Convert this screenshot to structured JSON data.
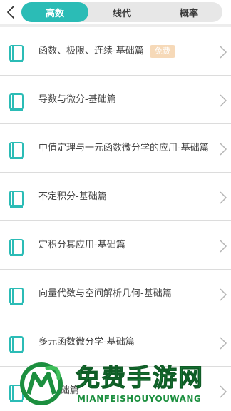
{
  "colors": {
    "accent": "#2bbcb6",
    "badge": "#f6d9b8",
    "watermark": "#1c8f3f"
  },
  "header": {
    "back_icon": "chevron-left-icon",
    "tabs": [
      {
        "label": "高数",
        "active": true
      },
      {
        "label": "线代",
        "active": false
      },
      {
        "label": "概率",
        "active": false
      }
    ]
  },
  "list": {
    "item_icon": "book-icon",
    "items": [
      {
        "title": "函数、极限、连续-基础篇",
        "badge": "免费"
      },
      {
        "title": "导数与微分-基础篇"
      },
      {
        "title": "中值定理与一元函数微分学的应用-基础篇"
      },
      {
        "title": "不定积分-基础篇"
      },
      {
        "title": "定积分其应用-基础篇"
      },
      {
        "title": "向量代数与空间解析几何-基础篇"
      },
      {
        "title": "多元函数微分学-基础篇"
      },
      {
        "title": "分-基础篇"
      }
    ]
  },
  "watermark": {
    "title": "免费手游网",
    "subtitle": "MIANFEISHOUYOUWANG"
  }
}
